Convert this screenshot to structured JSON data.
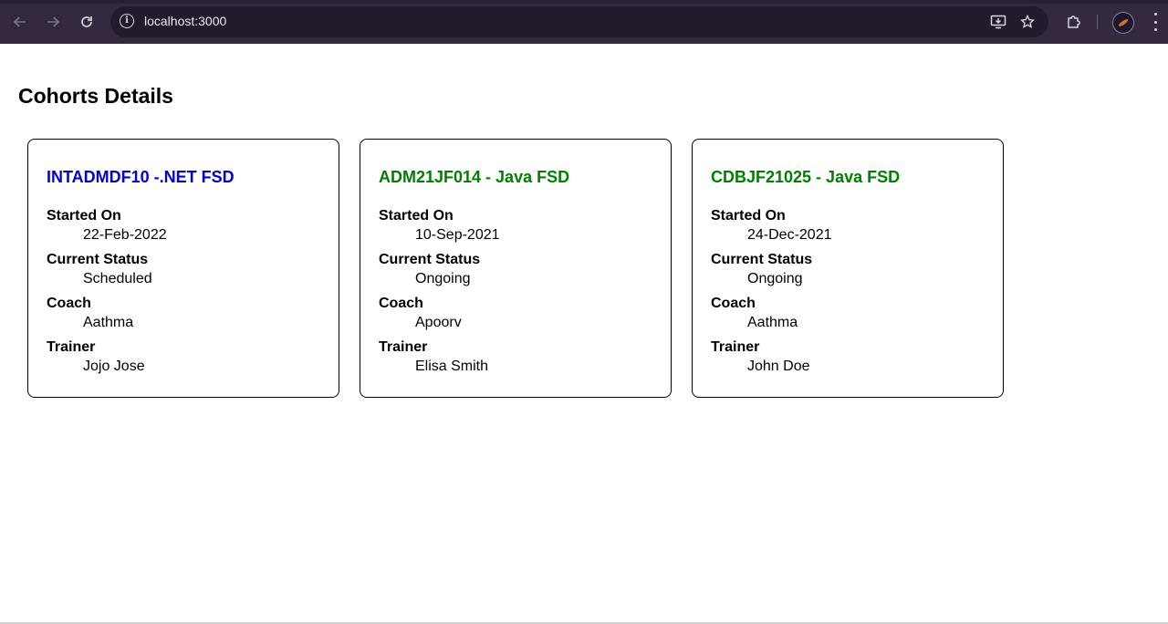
{
  "browser": {
    "url": "localhost:3000"
  },
  "page": {
    "title": "Cohorts Details"
  },
  "labels": {
    "started_on": "Started On",
    "current_status": "Current Status",
    "coach": "Coach",
    "trainer": "Trainer"
  },
  "cohorts": [
    {
      "title": "INTADMDF10 -.NET FSD",
      "title_color": "#0000dd",
      "started_on": "22-Feb-2022",
      "current_status": "Scheduled",
      "coach": "Aathma",
      "trainer": "Jojo Jose"
    },
    {
      "title": "ADM21JF014 - Java FSD",
      "title_color": "#008000",
      "started_on": "10-Sep-2021",
      "current_status": "Ongoing",
      "coach": "Apoorv",
      "trainer": "Elisa Smith"
    },
    {
      "title": "CDBJF21025 - Java FSD",
      "title_color": "#008000",
      "started_on": "24-Dec-2021",
      "current_status": "Ongoing",
      "coach": "Aathma",
      "trainer": "John Doe"
    }
  ],
  "icons": {
    "back": "arrow-left-icon",
    "forward": "arrow-right-icon",
    "reload": "reload-icon",
    "site_info": "info-icon",
    "install": "install-app-icon",
    "bookmark": "star-icon",
    "extensions": "puzzle-icon",
    "profile": "avatar",
    "menu": "kebab-menu-icon"
  }
}
